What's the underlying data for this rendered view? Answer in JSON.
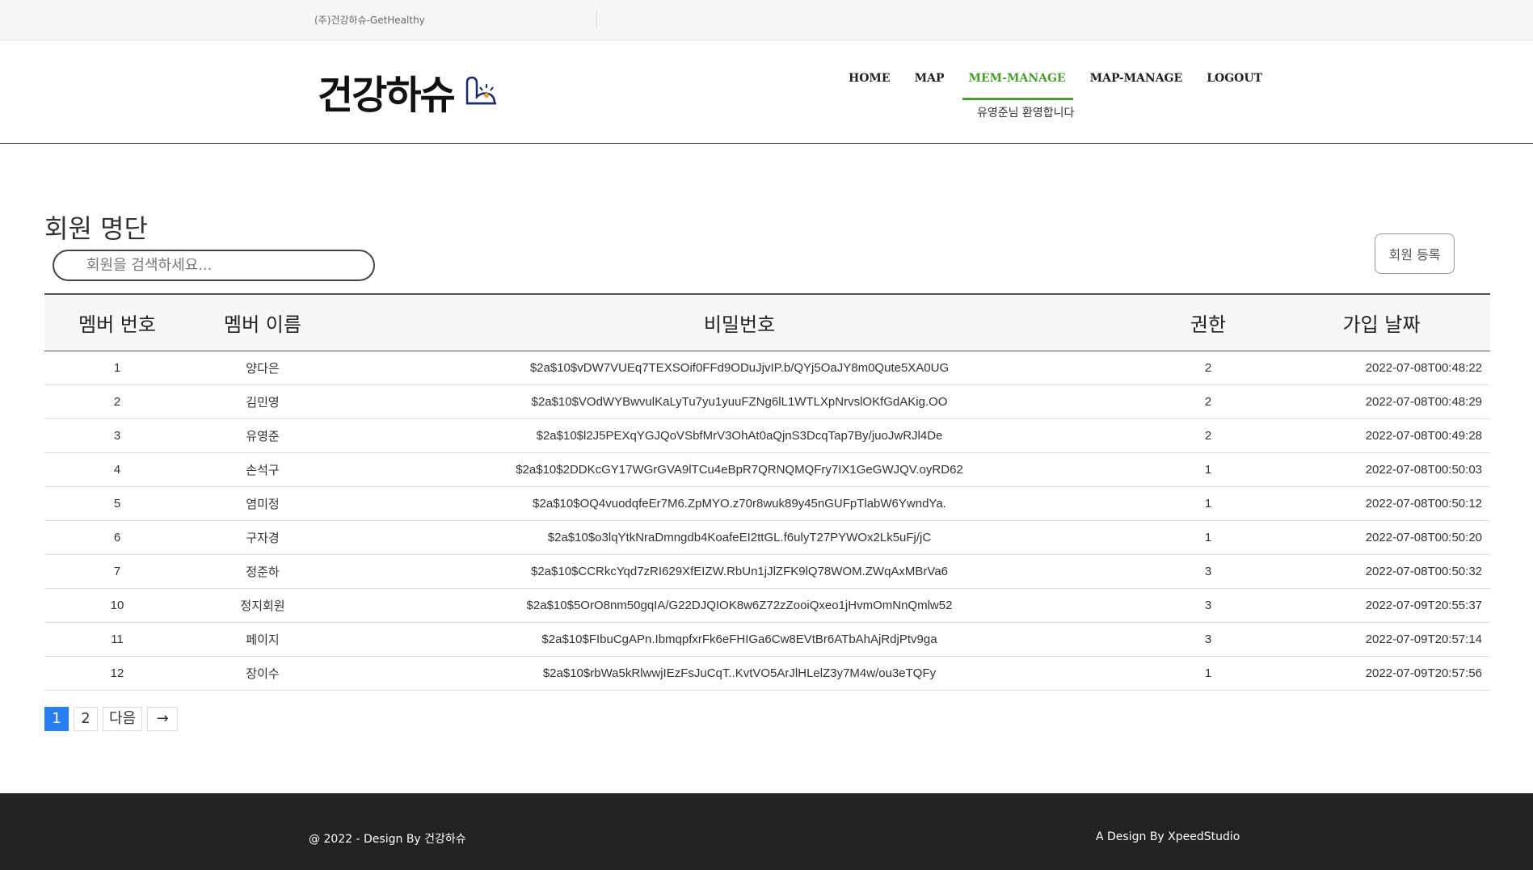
{
  "topbar": {
    "company": "(주)건강하슈-GetHealthy"
  },
  "header": {
    "logo_text": "건강하슈",
    "nav": [
      {
        "label": "HOME",
        "active": false
      },
      {
        "label": "MAP",
        "active": false
      },
      {
        "label": "MEM-MANAGE",
        "active": true
      },
      {
        "label": "MAP-MANAGE",
        "active": false
      },
      {
        "label": "LOGOUT",
        "active": false
      }
    ],
    "welcome": "유영준님 환영합니다"
  },
  "main": {
    "title": "회원 명단",
    "search_placeholder": "회원을 검색하세요...",
    "register_button": "회원 등록",
    "columns": [
      "멤버 번호",
      "멤버 이름",
      "비밀번호",
      "권한",
      "가입 날짜"
    ],
    "rows": [
      [
        "1",
        "양다은",
        "$2a$10$vDW7VUEq7TEXSOif0FFd9ODuJjvIP.b/QYj5OaJY8m0Qute5XA0UG",
        "2",
        "2022-07-08T00:48:22"
      ],
      [
        "2",
        "김민영",
        "$2a$10$VOdWYBwvulKaLyTu7yu1yuuFZNg6lL1WTLXpNrvslOKfGdAKig.OO",
        "2",
        "2022-07-08T00:48:29"
      ],
      [
        "3",
        "유영준",
        "$2a$10$l2J5PEXqYGJQoVSbfMrV3OhAt0aQjnS3DcqTap7By/juoJwRJl4De",
        "2",
        "2022-07-08T00:49:28"
      ],
      [
        "4",
        "손석구",
        "$2a$10$2DDKcGY17WGrGVA9lTCu4eBpR7QRNQMQFry7IX1GeGWJQV.oyRD62",
        "1",
        "2022-07-08T00:50:03"
      ],
      [
        "5",
        "염미정",
        "$2a$10$OQ4vuodqfeEr7M6.ZpMYO.z70r8wuk89y45nGUFpTlabW6YwndYa.",
        "1",
        "2022-07-08T00:50:12"
      ],
      [
        "6",
        "구자경",
        "$2a$10$o3lqYtkNraDmngdb4KoafeEI2ttGL.f6ulyT27PYWOx2Lk5uFj/jC",
        "1",
        "2022-07-08T00:50:20"
      ],
      [
        "7",
        "정준하",
        "$2a$10$CCRkcYqd7zRI629XfEIZW.RbUn1jJlZFK9lQ78WOM.ZWqAxMBrVa6",
        "3",
        "2022-07-08T00:50:32"
      ],
      [
        "10",
        "정지회원",
        "$2a$10$5OrO8nm50gqIA/G22DJQIOK8w6Z72zZooiQxeo1jHvmOmNnQmlw52",
        "3",
        "2022-07-09T20:55:37"
      ],
      [
        "11",
        "페이지",
        "$2a$10$FIbuCgAPn.IbmqpfxrFk6eFHIGa6Cw8EVtBr6ATbAhAjRdjPtv9ga",
        "3",
        "2022-07-09T20:57:14"
      ],
      [
        "12",
        "장이수",
        "$2a$10$rbWa5kRlwwjIEzFsJuCqT..KvtVO5ArJlHLelZ3y7M4w/ou3eTQFy",
        "1",
        "2022-07-09T20:57:56"
      ]
    ],
    "pagination": {
      "pages": [
        "1",
        "2"
      ],
      "current": "1",
      "next_label": "다음",
      "arrow_label": "→"
    }
  },
  "footer": {
    "left": "@ 2022 - Design By 건강하슈",
    "right": "A Design By XpeedStudio"
  },
  "colors": {
    "accent": "#4a9e2f",
    "pagination_active": "#2a7ff0",
    "footer_bg": "#222222"
  }
}
